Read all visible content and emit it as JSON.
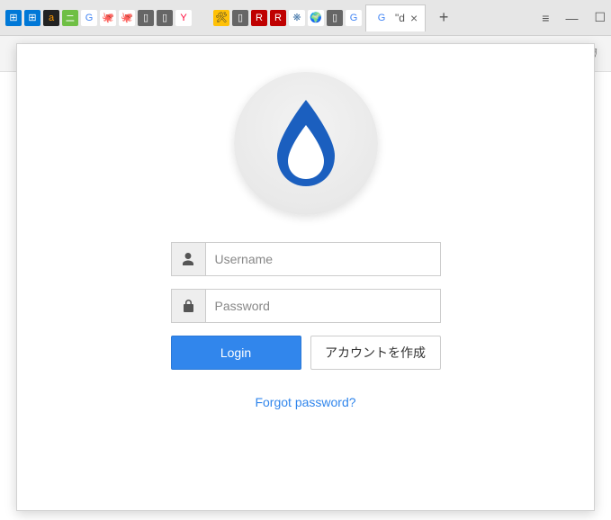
{
  "chrome": {
    "tab_favicons": [
      {
        "name": "microsoft-tiles-icon",
        "bg": "#0078d7",
        "fg": "#fff",
        "glyph": "⊞"
      },
      {
        "name": "microsoft-tiles-icon-2",
        "bg": "#0078d7",
        "fg": "#fff",
        "glyph": "⊞"
      },
      {
        "name": "amazon-icon",
        "bg": "#222",
        "fg": "#ff9900",
        "glyph": "a"
      },
      {
        "name": "nitori-icon",
        "bg": "#6fbf44",
        "fg": "#fff",
        "glyph": "ニ"
      },
      {
        "name": "google-icon",
        "bg": "#fff",
        "fg": "#4285F4",
        "glyph": "G"
      },
      {
        "name": "octopus-icon",
        "bg": "#fff",
        "fg": "#333",
        "glyph": "🐙"
      },
      {
        "name": "octopus-icon-2",
        "bg": "#fff",
        "fg": "#333",
        "glyph": "🐙"
      },
      {
        "name": "doc-icon",
        "bg": "#666",
        "fg": "#fff",
        "glyph": "▯"
      },
      {
        "name": "doc-icon-2",
        "bg": "#666",
        "fg": "#fff",
        "glyph": "▯"
      },
      {
        "name": "yahoo-icon",
        "bg": "#fff",
        "fg": "#ff0033",
        "glyph": "Y"
      },
      {
        "name": "blank-tab",
        "bg": "transparent",
        "fg": "#fff",
        "glyph": ""
      },
      {
        "name": "construction-icon",
        "bg": "#ffc107",
        "fg": "#333",
        "glyph": "🛠"
      },
      {
        "name": "doc-icon-3",
        "bg": "#666",
        "fg": "#fff",
        "glyph": "▯"
      },
      {
        "name": "rakuten-icon",
        "bg": "#bf0000",
        "fg": "#fff",
        "glyph": "R"
      },
      {
        "name": "rakuten-icon-2",
        "bg": "#bf0000",
        "fg": "#fff",
        "glyph": "R"
      },
      {
        "name": "firework-icon",
        "bg": "#fff",
        "fg": "#47a",
        "glyph": "❋"
      },
      {
        "name": "africa-icon",
        "bg": "#fff",
        "fg": "#f5a623",
        "glyph": "🌍"
      },
      {
        "name": "doc-icon-4",
        "bg": "#666",
        "fg": "#fff",
        "glyph": "▯"
      },
      {
        "name": "google-icon-2",
        "bg": "#fff",
        "fg": "#4285F4",
        "glyph": "G"
      }
    ],
    "active_tab": {
      "favicon_glyph": "G",
      "title": "\"d"
    },
    "right_icons": {
      "down": "≡",
      "min": "—",
      "max": "☐"
    }
  },
  "toolbar": {
    "icons": [
      {
        "name": "send-icon",
        "glyph": "➢",
        "active": false
      },
      {
        "name": "heart-icon",
        "glyph": "♡",
        "active": false
      },
      {
        "name": "cloud-icon",
        "glyph": "☁",
        "active": false,
        "color": "#3186ec"
      },
      {
        "name": "drop-icon",
        "glyph": "💧",
        "active": true,
        "color": "#1b5fbf"
      },
      {
        "name": "shield-icon",
        "glyph": "🛡",
        "active": false,
        "color": "#555"
      }
    ]
  },
  "login": {
    "username_placeholder": "Username",
    "password_placeholder": "Password",
    "login_label": "Login",
    "create_account_label": "アカウントを作成",
    "forgot_label": "Forgot password?"
  },
  "colors": {
    "primary": "#1b5fbf",
    "button": "#3186ec"
  }
}
